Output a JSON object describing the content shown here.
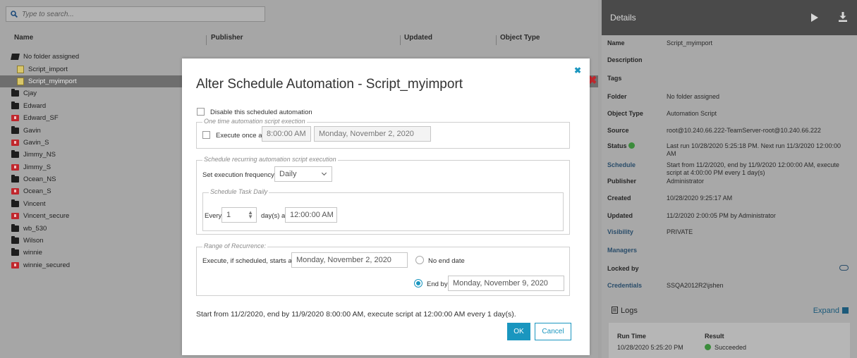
{
  "search": {
    "placeholder": "Type to search..."
  },
  "columns": {
    "name": "Name",
    "publisher": "Publisher",
    "updated": "Updated",
    "object_type": "Object Type"
  },
  "tree": [
    {
      "label": "No folder assigned",
      "kind": "open-folder"
    },
    {
      "label": "Script_import",
      "kind": "script"
    },
    {
      "label": "Script_myimport",
      "kind": "script",
      "selected": true
    },
    {
      "label": "Cjay",
      "kind": "folder"
    },
    {
      "label": "Edward",
      "kind": "folder"
    },
    {
      "label": "Edward_SF",
      "kind": "secure-folder"
    },
    {
      "label": "Gavin",
      "kind": "folder"
    },
    {
      "label": "Gavin_S",
      "kind": "secure-folder"
    },
    {
      "label": "Jimmy_NS",
      "kind": "folder"
    },
    {
      "label": "Jimmy_S",
      "kind": "secure-folder"
    },
    {
      "label": "Ocean_NS",
      "kind": "folder"
    },
    {
      "label": "Ocean_S",
      "kind": "secure-folder"
    },
    {
      "label": "Vincent",
      "kind": "folder"
    },
    {
      "label": "Vincent_secure",
      "kind": "secure-folder"
    },
    {
      "label": "wb_530",
      "kind": "folder"
    },
    {
      "label": "Wilson",
      "kind": "folder"
    },
    {
      "label": "winnie",
      "kind": "folder"
    },
    {
      "label": "winnie_secured",
      "kind": "secure-folder"
    }
  ],
  "details": {
    "title": "Details",
    "rows": [
      {
        "label": "Name",
        "value": "Script_myimport"
      },
      {
        "label": "Description",
        "value": ""
      },
      {
        "label": "Tags",
        "value": ""
      },
      {
        "label": "Folder",
        "value": "No folder assigned"
      },
      {
        "label": "Object Type",
        "value": "Automation Script"
      },
      {
        "label": "Source",
        "value": "root@10.240.66.222-TeamServer-root@10.240.66.222"
      },
      {
        "label": "Status",
        "value": "Last run 10/28/2020 5:25:18 PM. Next run 11/3/2020 12:00:00 AM"
      },
      {
        "label": "Schedule",
        "value": "Start from 11/2/2020, end by 11/9/2020 12:00:00 AM, execute script at 4:00:00 PM every 1 day(s)"
      },
      {
        "label": "Publisher",
        "value": "Administrator"
      },
      {
        "label": "Created",
        "value": "10/28/2020 9:25:17 AM"
      },
      {
        "label": "Updated",
        "value": "11/2/2020 2:00:05 PM by Administrator"
      },
      {
        "label": "Visibility",
        "value": "PRIVATE"
      },
      {
        "label": "Managers",
        "value": ""
      },
      {
        "label": "Locked by",
        "value": ""
      },
      {
        "label": "Credentials",
        "value": "SSQA2012R2\\jshen"
      }
    ],
    "logs": {
      "title": "Logs",
      "expand": "Expand",
      "col_run_time": "Run Time",
      "col_result": "Result",
      "run_time": "10/28/2020 5:25:20 PM",
      "result": "Succeeded"
    }
  },
  "modal": {
    "title": "Alter Schedule Automation - Script_myimport",
    "disable_label": "Disable this scheduled automation",
    "one_time": {
      "legend": "One time automation script exection",
      "execute_label": "Execute once at:",
      "time": "8:00:00 AM",
      "date": "Monday, November 2, 2020"
    },
    "recurring": {
      "legend": "Schedule recurring automation script execution",
      "freq_label": "Set execution frequency:",
      "freq_value": "Daily",
      "daily_legend": "Schedule Task Daily",
      "every_label": "Every",
      "every_value": "1",
      "days_at_label": "day(s) at",
      "time": "12:00:00 AM"
    },
    "range": {
      "legend": "Range of Recurrence:",
      "starts_label": "Execute, if scheduled, starts at:",
      "start_date": "Monday, November 2, 2020",
      "no_end_label": "No end date",
      "end_by_label": "End by:",
      "end_date": "Monday, November 9, 2020"
    },
    "summary": "Start from 11/2/2020, end by 11/9/2020 8:00:00 AM, execute script at 12:00:00 AM every 1 day(s).",
    "ok_label": "OK",
    "cancel_label": "Cancel"
  },
  "colors": {
    "accent": "#1a96bf",
    "status_ok": "#3c8c3c",
    "secure_folder": "#c0272d"
  }
}
